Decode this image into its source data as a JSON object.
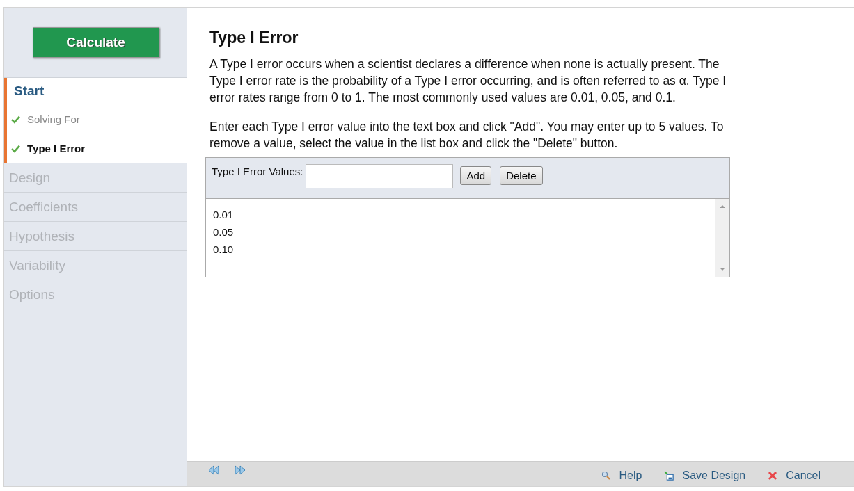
{
  "sidebar": {
    "calculate_button": "Calculate",
    "sections": [
      {
        "label": "Start",
        "selected": true,
        "children": [
          {
            "label": "Solving For",
            "checked": true,
            "selected": false
          },
          {
            "label": "Type I Error",
            "checked": true,
            "selected": true
          }
        ]
      },
      {
        "label": "Design",
        "selected": false
      },
      {
        "label": "Coefficients",
        "selected": false
      },
      {
        "label": "Hypothesis",
        "selected": false
      },
      {
        "label": "Variability",
        "selected": false
      },
      {
        "label": "Options",
        "selected": false
      }
    ]
  },
  "main": {
    "title": "Type I Error",
    "paragraphs": [
      "A Type I error occurs when a scientist declares a difference when none is actually present. The Type I error rate is the probability of a Type I error occurring, and is often referred to as α. Type I error rates range from 0 to 1. The most commonly used values are 0.01, 0.05, and 0.1.",
      "Enter each Type I error value into the text box and click \"Add\". You may enter up to 5 values. To remove a value, select the value in the list box and click the \"Delete\" button."
    ],
    "values_panel": {
      "label": "Type I Error Values:",
      "add_button": "Add",
      "delete_button": "Delete",
      "values": [
        "0.01",
        "0.05",
        "0.10"
      ]
    }
  },
  "footer": {
    "help": "Help",
    "save": "Save Design",
    "cancel": "Cancel"
  }
}
